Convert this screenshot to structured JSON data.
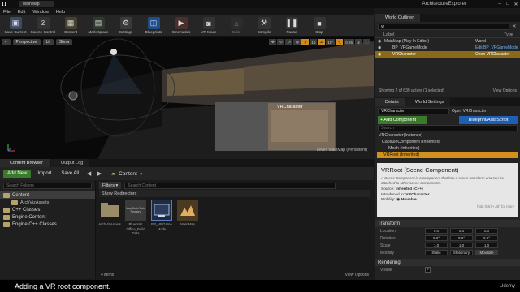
{
  "window": {
    "tab_title": "MainMap",
    "project": "ArchitectureExplorer",
    "logo": "U"
  },
  "menu": [
    "File",
    "Edit",
    "Window",
    "Help"
  ],
  "toolbar": [
    {
      "label": "Save Current",
      "icon": "save-icon"
    },
    {
      "label": "Source Control",
      "icon": "source-control-icon"
    },
    {
      "label": "Content",
      "icon": "content-icon"
    },
    {
      "label": "Marketplace",
      "icon": "marketplace-icon"
    },
    {
      "label": "Settings",
      "icon": "settings-icon"
    },
    {
      "label": "Blueprints",
      "icon": "blueprints-icon"
    },
    {
      "label": "Cinematics",
      "icon": "cinematics-icon"
    },
    {
      "label": "VR Mode",
      "icon": "vr-mode-icon"
    },
    {
      "label": "Build",
      "icon": "build-icon"
    },
    {
      "label": "Compile",
      "icon": "compile-icon"
    },
    {
      "label": "Pause",
      "icon": "pause-icon"
    },
    {
      "label": "Stop",
      "icon": "stop-icon"
    }
  ],
  "viewport": {
    "perspective": "Perspective",
    "lit": "Lit",
    "show": "Show",
    "grid_value": "10",
    "angle_value": "10°",
    "scale_value": "0.25",
    "camera_speed": "4",
    "pip_title": "VRCharacter",
    "level_label": "Level:  MainMap (Persistent)"
  },
  "content_browser": {
    "tabs": [
      "Content Browser",
      "Output Log"
    ],
    "add_new": "Add New",
    "import": "Import",
    "save_all": "Save All",
    "path": "Content",
    "search_folders": "Search Folders",
    "filters": "Filters",
    "search_content": "Search Content",
    "show_redirectors": "Show Redirectors",
    "tree": [
      {
        "label": "Content",
        "level": 0,
        "selected": true
      },
      {
        "label": "ArchVizAssets",
        "level": 1,
        "selected": false
      },
      {
        "label": "C++ Classes",
        "level": 0,
        "selected": false
      },
      {
        "label": "Engine Content",
        "level": 0,
        "selected": false
      },
      {
        "label": "Engine C++ Classes",
        "level": 0,
        "selected": false
      }
    ],
    "assets": [
      {
        "name": "ArchVizAssets",
        "kind": "folder"
      },
      {
        "name": "Blueprint Office_Build Data",
        "kind": "data",
        "badge": "Map Build Data Registry"
      },
      {
        "name": "BP_VRGame Mode",
        "kind": "blueprint"
      },
      {
        "name": "MainMap",
        "kind": "map"
      }
    ],
    "item_count": "4 items",
    "view_options": "View Options"
  },
  "outliner": {
    "tab": "World Outliner",
    "search_value": "vr",
    "col_label": "Label",
    "col_type": "Type",
    "rows": [
      {
        "label": "MainMap (Play In Editor)",
        "type": "World",
        "highlight": false
      },
      {
        "label": "BP_VRGameMode",
        "type": "Edit BP_VRGameMode_C",
        "highlight": false
      },
      {
        "label": "VRCharacter",
        "type": "Open VRCharacter",
        "highlight": true
      }
    ],
    "status": "Showing 2 of 639 actors (1 selected)",
    "view_options": "View Options"
  },
  "details": {
    "tabs": [
      "Details",
      "World Settings"
    ],
    "name_value": "VRCharacter",
    "open_link": "Open VRCharacter",
    "add_component": "+ Add Component",
    "blueprint_btn": "Blueprint/Add Script",
    "search_placeholder": "Search",
    "components": [
      {
        "label": "VRCharacter(Instance)",
        "indent": 0,
        "selected": false
      },
      {
        "label": "CapsuleComponent (Inherited)",
        "indent": 1,
        "selected": false
      },
      {
        "label": "Mesh (Inherited)",
        "indent": 2,
        "selected": false
      },
      {
        "label": "VRRoot (Inherited)",
        "indent": 1,
        "selected": true
      }
    ],
    "tooltip": {
      "title": "VRRoot (Scene Component)",
      "desc": "A Scene Component is a component that has a scene transform and can be attached to other scene components.",
      "source_label": "Source:",
      "source_value": "Inherited (C++)",
      "intro_label": "Introduced in:",
      "intro_value": "VRCharacter",
      "mobility_label": "Mobility:",
      "mobility_value": "Movable",
      "hint": "hold (Ctrl + Alt) for more"
    },
    "transform_header": "Transform",
    "props": [
      {
        "label": "Location",
        "values": [
          "0.0",
          "0.0",
          "0.0"
        ]
      },
      {
        "label": "Rotation",
        "values": [
          "0.0°",
          "0.0°",
          "0.0°"
        ]
      },
      {
        "label": "Scale",
        "values": [
          "1.0",
          "1.0",
          "1.0"
        ]
      },
      {
        "label": "Mobility",
        "values": [
          "Static",
          "Stationary",
          "Movable"
        ]
      }
    ],
    "rendering_header": "Rendering",
    "visible_label": "Visible"
  },
  "subtitle": {
    "text": "Adding a VR root component.",
    "logo": "Udemy"
  },
  "colors": {
    "accent_orange": "#d4901c",
    "add_green": "#3a7a2a",
    "blueprint_blue": "#1e5fb4"
  }
}
